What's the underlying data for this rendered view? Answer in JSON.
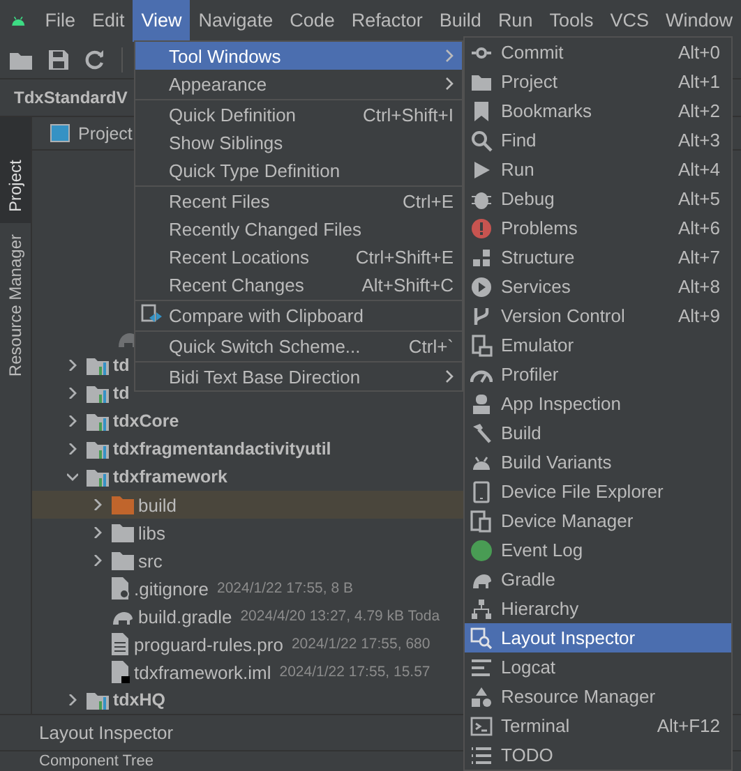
{
  "menu_bar": [
    {
      "label": "File",
      "selected": false
    },
    {
      "label": "Edit",
      "selected": false
    },
    {
      "label": "View",
      "selected": true
    },
    {
      "label": "Navigate",
      "selected": false
    },
    {
      "label": "Code",
      "selected": false
    },
    {
      "label": "Refactor",
      "selected": false
    },
    {
      "label": "Build",
      "selected": false
    },
    {
      "label": "Run",
      "selected": false
    },
    {
      "label": "Tools",
      "selected": false
    },
    {
      "label": "VCS",
      "selected": false
    },
    {
      "label": "Window",
      "selected": false
    }
  ],
  "breadcrumb": "TdxStandardV",
  "side_tabs": [
    {
      "label": "Project",
      "selected": true
    },
    {
      "label": "Resource Manager",
      "selected": false
    }
  ],
  "project_panel": {
    "title": "Project",
    "tree": [
      {
        "label": "td",
        "kind": "module",
        "expanded": false,
        "selected": false
      },
      {
        "label": "td",
        "kind": "module",
        "expanded": false,
        "selected": false
      },
      {
        "label": "tdxCore",
        "kind": "module",
        "expanded": false,
        "selected": false
      },
      {
        "label": "tdxfragmentandactivityutil",
        "kind": "module",
        "expanded": false,
        "selected": false
      },
      {
        "label": "tdxframework",
        "kind": "module",
        "expanded": true,
        "selected": false,
        "children": [
          {
            "label": "build",
            "kind": "excluded-folder",
            "expanded": false,
            "selected": true
          },
          {
            "label": "libs",
            "kind": "folder",
            "expanded": false,
            "selected": false
          },
          {
            "label": "src",
            "kind": "folder",
            "expanded": false,
            "selected": false
          },
          {
            "label": ".gitignore",
            "kind": "ignore-file",
            "info": "2024/1/22 17:55, 8 B",
            "selected": false
          },
          {
            "label": "build.gradle",
            "kind": "gradle-file",
            "info": "2024/4/20 13:27, 4.79 kB Toda",
            "selected": false
          },
          {
            "label": "proguard-rules.pro",
            "kind": "text-file",
            "info": "2024/1/22 17:55, 680",
            "selected": false
          },
          {
            "label": "tdxframework.iml",
            "kind": "iml-file",
            "info": "2024/1/22 17:55, 15.57",
            "selected": false
          }
        ]
      },
      {
        "label": "tdxHQ",
        "kind": "module",
        "expanded": false,
        "selected": false
      }
    ]
  },
  "bottom_panel": {
    "title": "Layout Inspector",
    "subtitle": "Component Tree"
  },
  "view_menu": [
    [
      {
        "label": "Tool Windows",
        "submenu": true,
        "selected": true
      },
      {
        "label": "Appearance",
        "submenu": true,
        "selected": false
      }
    ],
    [
      {
        "label": "Quick Definition",
        "shortcut": "Ctrl+Shift+I",
        "selected": false
      },
      {
        "label": "Show Siblings",
        "selected": false
      },
      {
        "label": "Quick Type Definition",
        "selected": false
      }
    ],
    [
      {
        "label": "Recent Files",
        "shortcut": "Ctrl+E",
        "selected": false
      },
      {
        "label": "Recently Changed Files",
        "selected": false
      },
      {
        "label": "Recent Locations",
        "shortcut": "Ctrl+Shift+E",
        "selected": false
      },
      {
        "label": "Recent Changes",
        "shortcut": "Alt+Shift+C",
        "selected": false
      }
    ],
    [
      {
        "label": "Compare with Clipboard",
        "icon": true,
        "selected": false
      }
    ],
    [
      {
        "label": "Quick Switch Scheme...",
        "shortcut": "Ctrl+`",
        "selected": false
      }
    ],
    [
      {
        "label": "Bidi Text Base Direction",
        "submenu": true,
        "selected": false
      }
    ]
  ],
  "tool_windows_menu": [
    {
      "label": "Commit",
      "shortcut": "Alt+0",
      "selected": false
    },
    {
      "label": "Project",
      "shortcut": "Alt+1",
      "selected": false
    },
    {
      "label": "Bookmarks",
      "shortcut": "Alt+2",
      "selected": false
    },
    {
      "label": "Find",
      "shortcut": "Alt+3",
      "selected": false
    },
    {
      "label": "Run",
      "shortcut": "Alt+4",
      "selected": false
    },
    {
      "label": "Debug",
      "shortcut": "Alt+5",
      "selected": false
    },
    {
      "label": "Problems",
      "shortcut": "Alt+6",
      "selected": false
    },
    {
      "label": "Structure",
      "shortcut": "Alt+7",
      "selected": false
    },
    {
      "label": "Services",
      "shortcut": "Alt+8",
      "selected": false
    },
    {
      "label": "Version Control",
      "shortcut": "Alt+9",
      "selected": false
    },
    {
      "label": "Emulator",
      "selected": false
    },
    {
      "label": "Profiler",
      "selected": false
    },
    {
      "label": "App Inspection",
      "selected": false
    },
    {
      "label": "Build",
      "selected": false
    },
    {
      "label": "Build Variants",
      "selected": false
    },
    {
      "label": "Device File Explorer",
      "selected": false
    },
    {
      "label": "Device Manager",
      "selected": false
    },
    {
      "label": "Event Log",
      "selected": false
    },
    {
      "label": "Gradle",
      "selected": false
    },
    {
      "label": "Hierarchy",
      "selected": false
    },
    {
      "label": "Layout Inspector",
      "selected": true
    },
    {
      "label": "Logcat",
      "selected": false
    },
    {
      "label": "Resource Manager",
      "selected": false
    },
    {
      "label": "Terminal",
      "shortcut": "Alt+F12",
      "selected": false
    },
    {
      "label": "TODO",
      "selected": false
    }
  ]
}
